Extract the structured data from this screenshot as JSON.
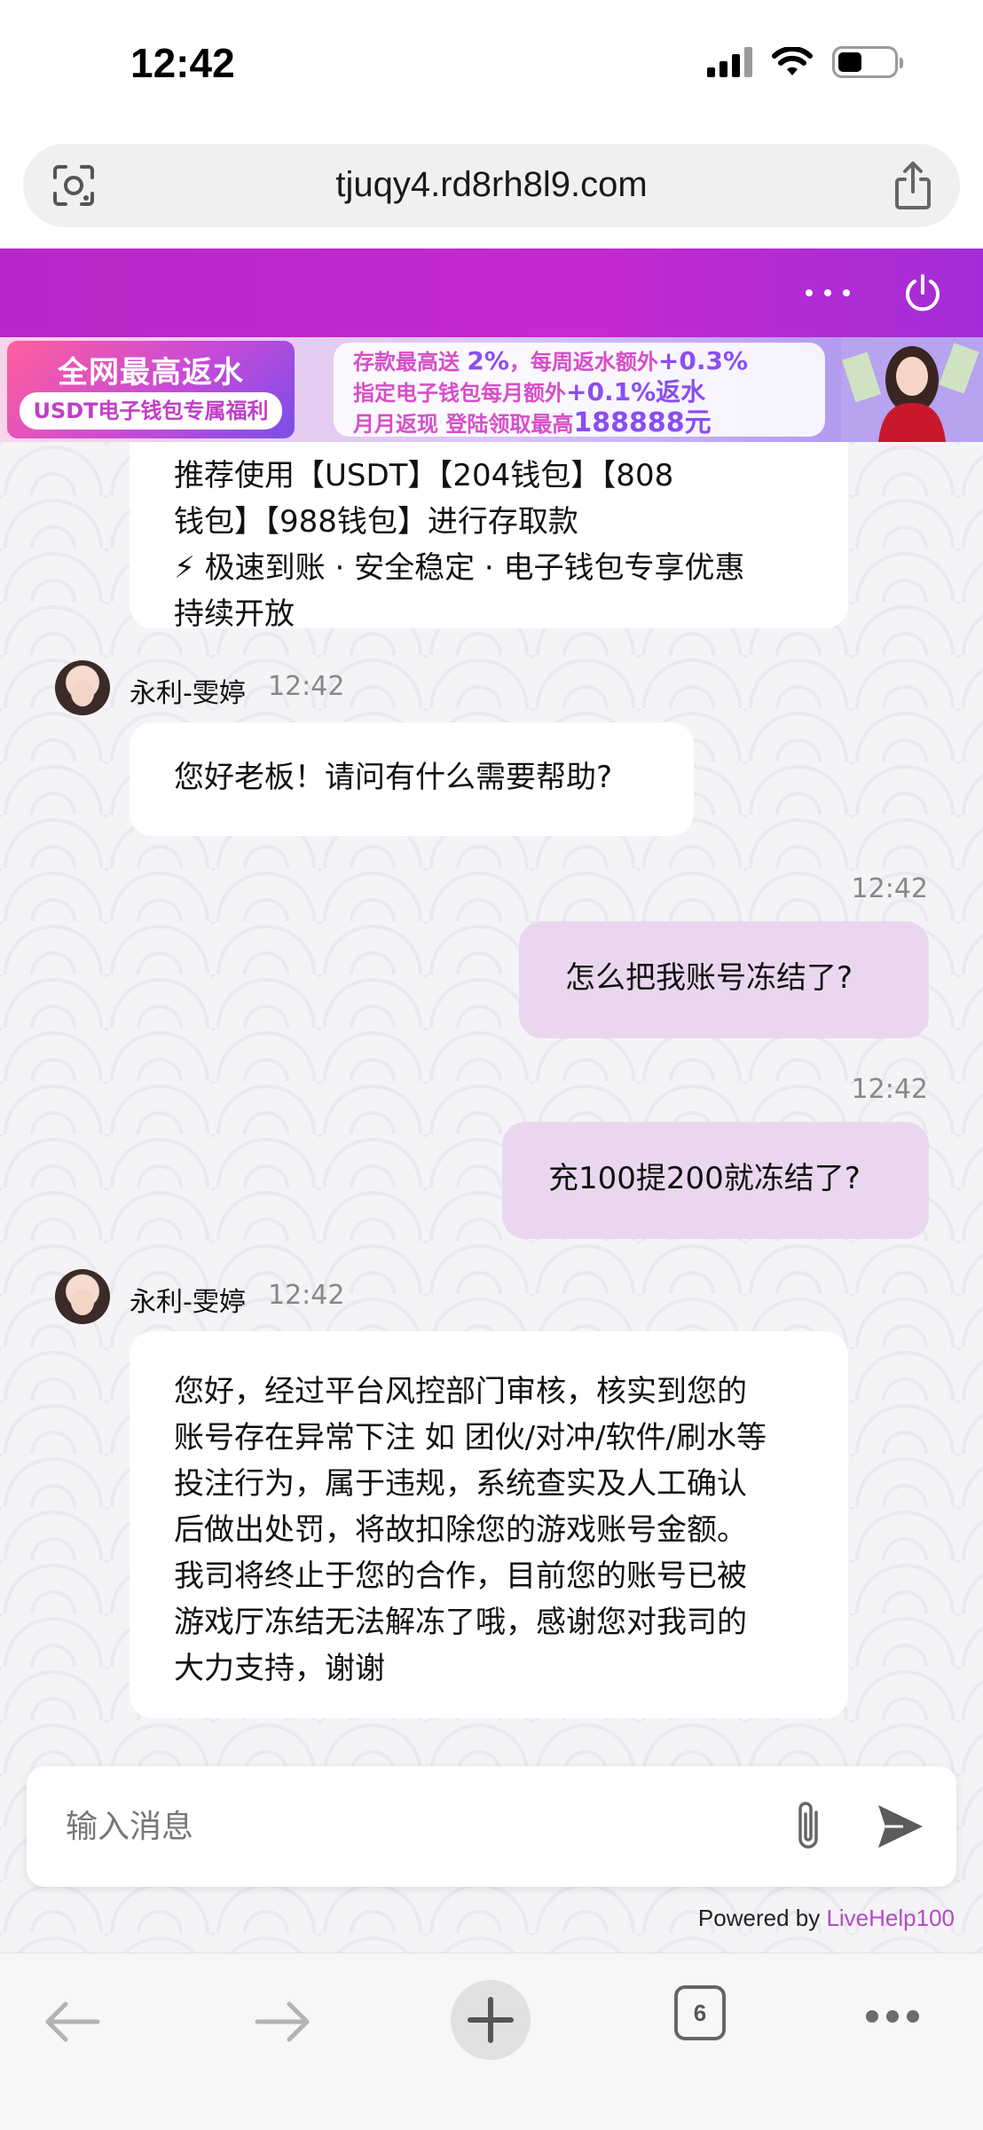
{
  "status_bar": {
    "time": "12:42"
  },
  "browser": {
    "url": "tjuqy4.rd8rh8l9.com",
    "tab_count": "6"
  },
  "banner": {
    "title": "全网最高返水",
    "subtitle": "USDT电子钱包专属福利",
    "line1_a": "存款最高送 ",
    "line1_b": "2%",
    "line1_c": "，每周返水额外",
    "line1_d": "+0.3%",
    "line2_a": "指定电子钱包每月额外",
    "line2_b": "+0.1%返水",
    "line3_a": "月月返现 登陆领取最高",
    "line3_b": "188888元"
  },
  "messages": {
    "top_partial": {
      "lines": [
        "推荐使用【USDT】【204钱包】【808",
        "钱包】【988钱包】进行存取款",
        "⚡ 极速到账 · 安全稳定 · 电子钱包专享优惠",
        "持续开放"
      ]
    },
    "agent1": {
      "sender": "永利-雯婷",
      "time": "12:42",
      "text": "您好老板！请问有什么需要帮助?"
    },
    "user1": {
      "time": "12:42",
      "text": "怎么把我账号冻结了?"
    },
    "user2": {
      "time": "12:42",
      "text": "充100提200就冻结了?"
    },
    "agent2": {
      "sender": "永利-雯婷",
      "time": "12:42",
      "lines": [
        "您好，经过平台风控部门审核，核实到您的",
        "账号存在异常下注 如 团伙/对冲/软件/刷水等",
        "投注行为，属于违规，系统查实及人工确认",
        "后做出处罚，将故扣除您的游戏账号金额。",
        "我司将终止于您的合作，目前您的账号已被",
        "游戏厅冻结无法解冻了哦，感谢您对我司的",
        "大力支持，谢谢"
      ]
    }
  },
  "input": {
    "placeholder": "输入消息"
  },
  "footer": {
    "powered_prefix": "Powered by ",
    "powered_brand": "LiveHelp100"
  }
}
